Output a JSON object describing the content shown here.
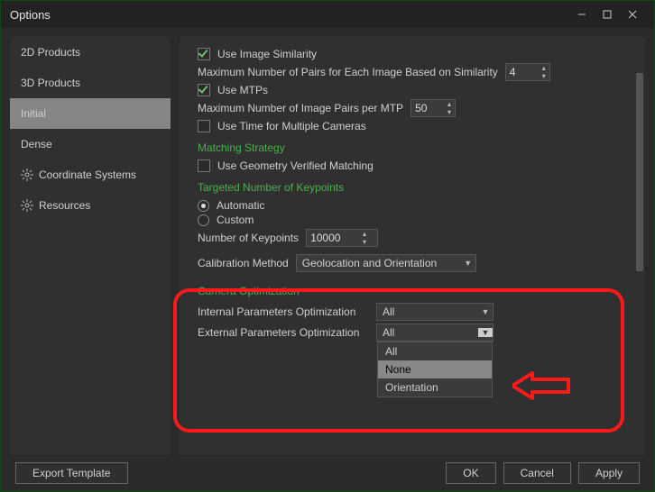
{
  "window": {
    "title": "Options"
  },
  "sidebar": {
    "items": [
      {
        "label": "2D Products"
      },
      {
        "label": "3D Products"
      },
      {
        "label": "Initial"
      },
      {
        "label": "Dense"
      },
      {
        "label": "Coordinate Systems"
      },
      {
        "label": "Resources"
      }
    ]
  },
  "content": {
    "use_image_similarity": "Use Image Similarity",
    "max_pairs_similarity": "Maximum Number of Pairs for Each Image Based on Similarity",
    "max_pairs_similarity_val": "4",
    "use_mtps": "Use MTPs",
    "max_pairs_mtp": "Maximum Number of Image Pairs per MTP",
    "max_pairs_mtp_val": "50",
    "use_time_cameras": "Use Time for Multiple Cameras",
    "matching_strategy": "Matching Strategy",
    "use_geom_verified": "Use Geometry Verified Matching",
    "targeted_keypoints": "Targeted Number of Keypoints",
    "automatic": "Automatic",
    "custom": "Custom",
    "num_keypoints_label": "Number of Keypoints",
    "num_keypoints_val": "10000",
    "calib_method_label": "Calibration Method",
    "calib_method_val": "Geolocation and Orientation",
    "cam_opt": "Camera Optimization",
    "internal_label": "Internal Parameters Optimization",
    "internal_val": "All",
    "external_label": "External Parameters Optimization",
    "external_val": "All",
    "ext_options": {
      "o0": "All",
      "o1": "None",
      "o2": "Orientation"
    }
  },
  "footer": {
    "export_template": "Export Template",
    "ok": "OK",
    "cancel": "Cancel",
    "apply": "Apply"
  }
}
